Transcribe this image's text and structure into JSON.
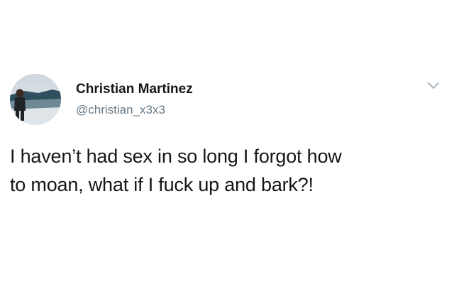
{
  "tweet": {
    "author": {
      "display_name": "Christian Martinez",
      "handle": "@christian_x3x3",
      "avatar": "profile-photo"
    },
    "menu_icon": "chevron-down-icon",
    "text_lines": [
      "I haven’t had sex in so long I forgot how",
      "to moan, what if I fuck up and bark?!"
    ]
  },
  "colors": {
    "text_primary": "#14171a",
    "text_secondary": "#657786",
    "chevron": "#aab8c2",
    "background": "#ffffff"
  }
}
